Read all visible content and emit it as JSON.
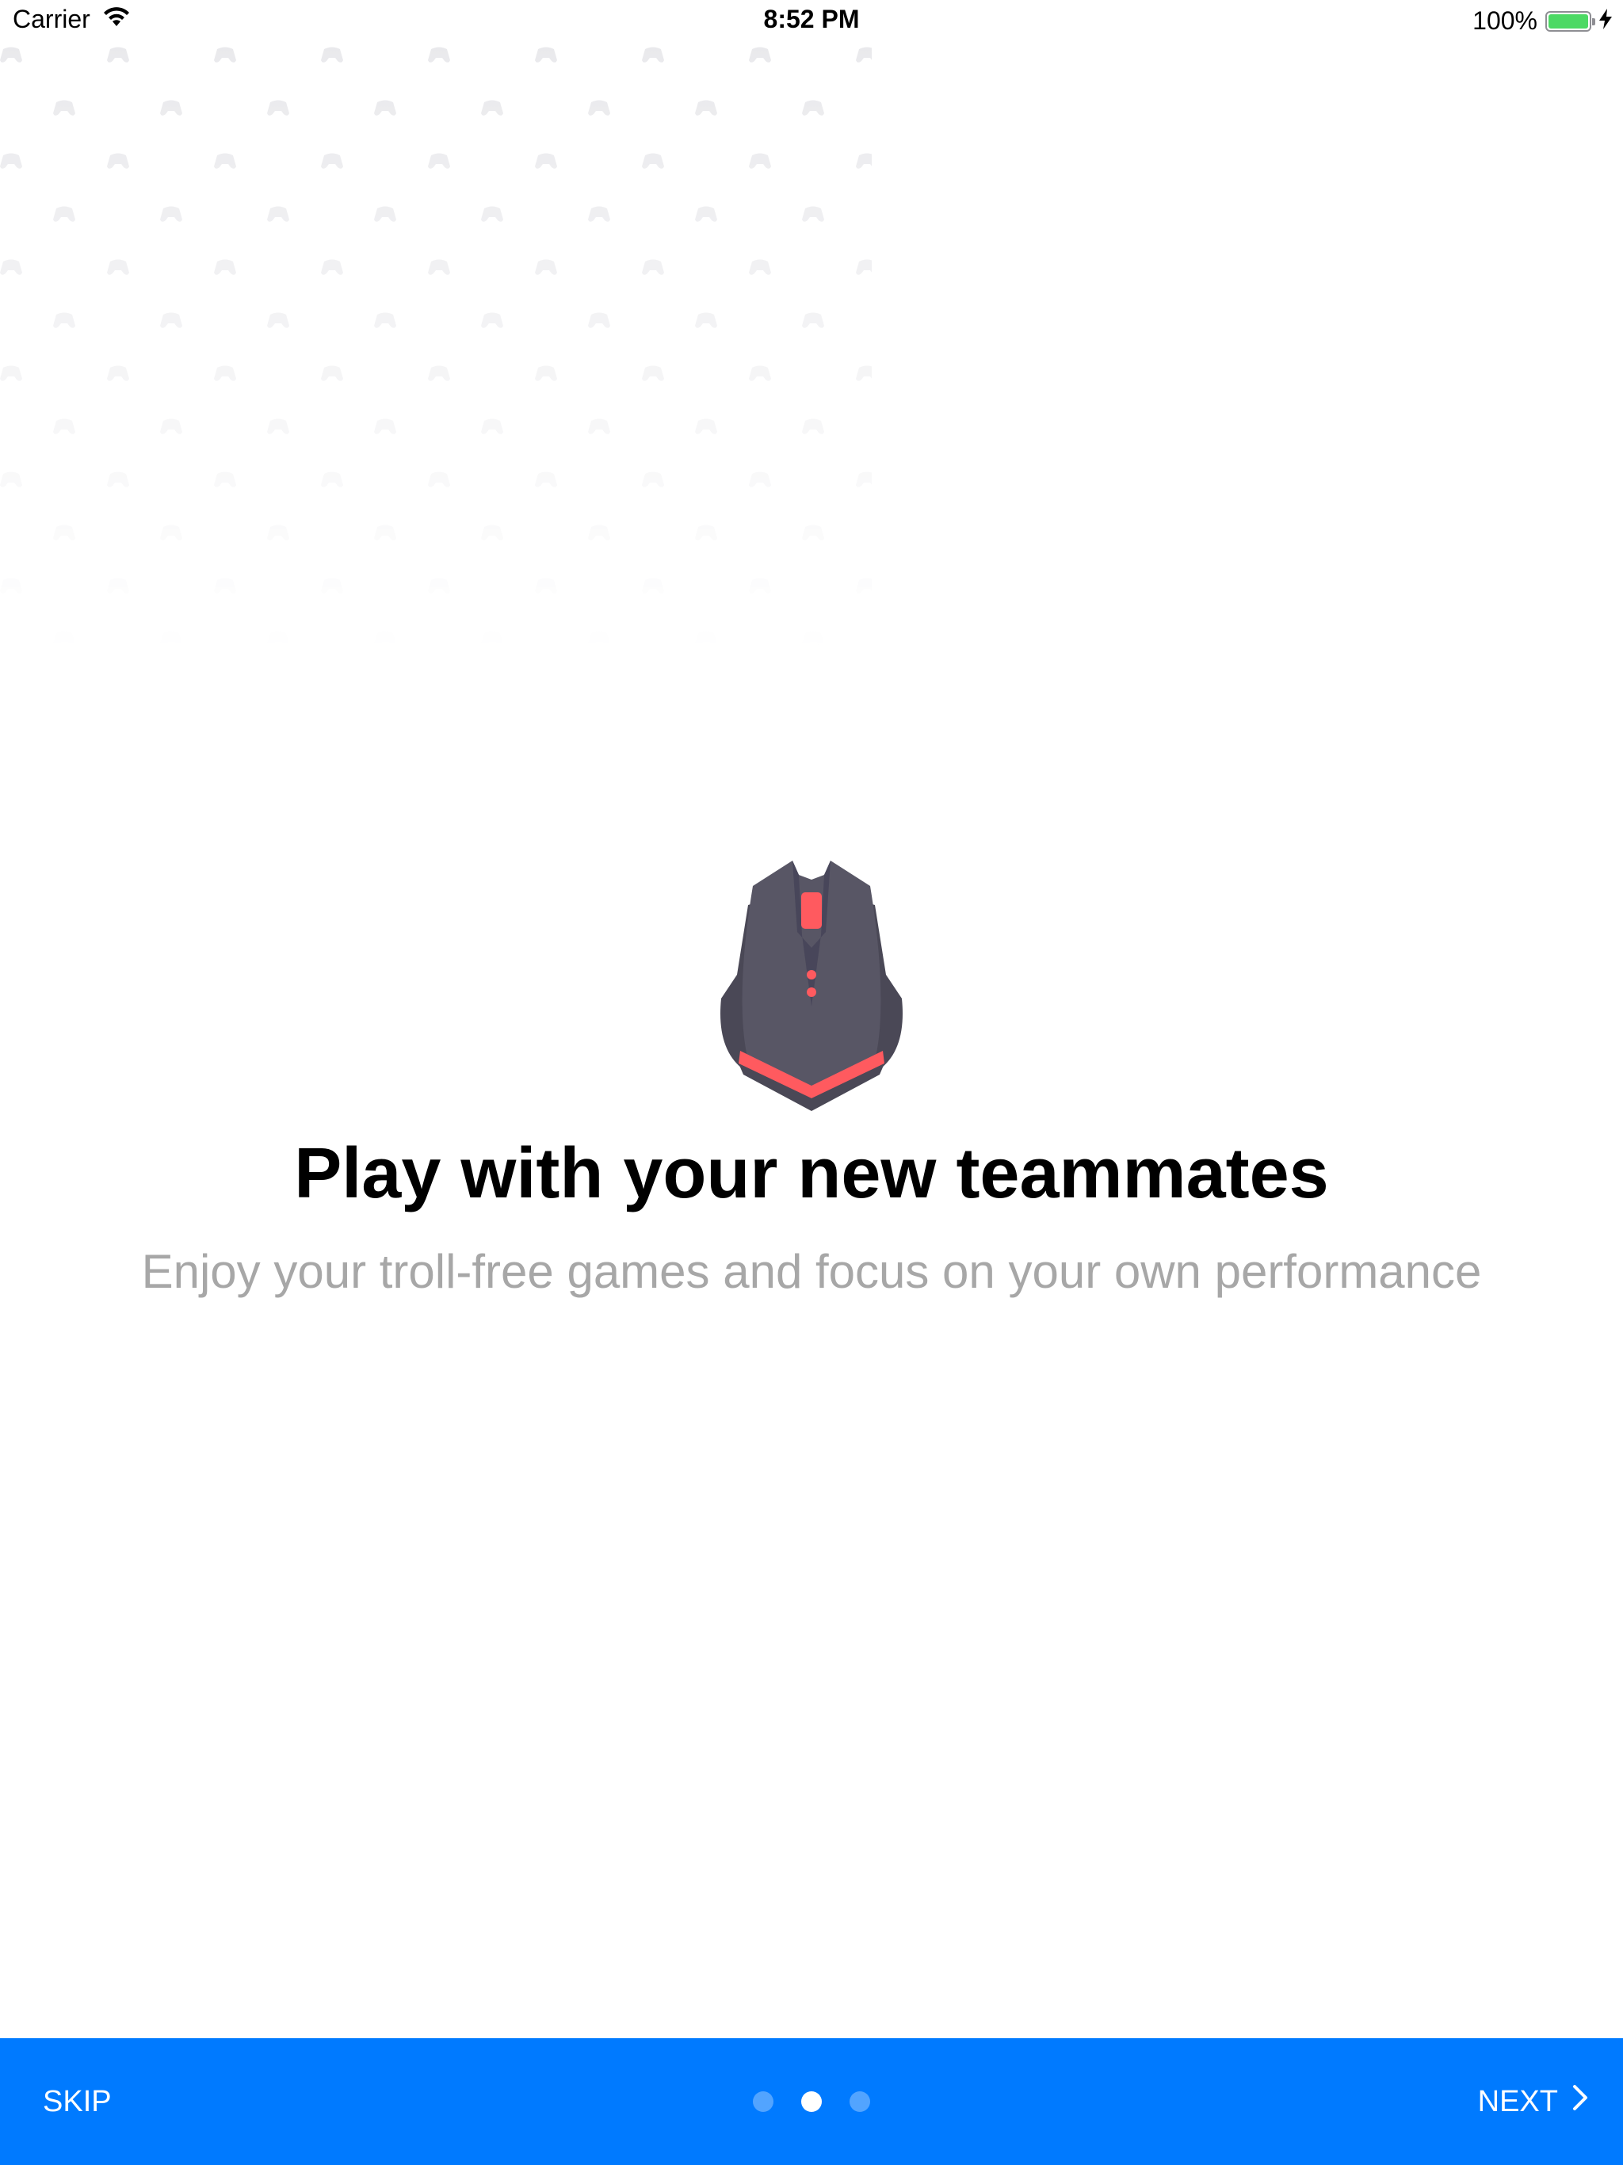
{
  "status_bar": {
    "carrier": "Carrier",
    "time": "8:52 PM",
    "battery_percent": "100%",
    "battery_level": 1.0,
    "icons": [
      "wifi-icon",
      "battery-icon",
      "charging-bolt-icon"
    ]
  },
  "background": {
    "pattern_icon": "gamepad-icon"
  },
  "onboarding": {
    "illustration": "gaming-mouse-icon",
    "title": "Play with your new teammates",
    "subtitle": "Enjoy your troll-free games and focus on your own performance"
  },
  "footer": {
    "skip_label": "SKIP",
    "next_label": "NEXT",
    "next_icon": "chevron-right-icon",
    "page_count": 3,
    "current_page": 2
  },
  "colors": {
    "accent": "#007aff",
    "mouse_body": "#575566",
    "mouse_accent": "#ff5a5f",
    "subtitle": "#a7a7a7",
    "battery": "#4cd964"
  }
}
